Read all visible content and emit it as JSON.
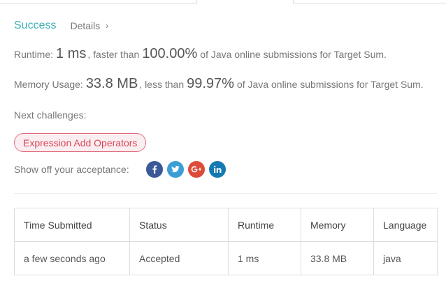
{
  "status": {
    "result": "Success",
    "details_label": "Details",
    "details_chevron": "›"
  },
  "runtime": {
    "label": "Runtime:",
    "value": "1 ms",
    "compare_text": ", faster than",
    "percent": "100.00%",
    "suffix": "of Java online submissions for Target Sum."
  },
  "memory": {
    "label": "Memory Usage:",
    "value": "33.8 MB",
    "compare_text": ", less than",
    "percent": "99.97%",
    "suffix": "of Java online submissions for Target Sum."
  },
  "next_challenges": {
    "label": "Next challenges:",
    "items": [
      "Expression Add Operators"
    ]
  },
  "share": {
    "label": "Show off your acceptance:",
    "icons": [
      "facebook-icon",
      "twitter-icon",
      "google-plus-icon",
      "linkedin-icon"
    ]
  },
  "table": {
    "headers": [
      "Time Submitted",
      "Status",
      "Runtime",
      "Memory",
      "Language"
    ],
    "rows": [
      [
        "a few seconds ago",
        "Accepted",
        "1 ms",
        "33.8 MB",
        "java"
      ]
    ]
  },
  "colors": {
    "success": "#3eb0b8",
    "accepted": "#2e9a5c",
    "challenge_border": "#e26b7c",
    "challenge_text": "#d9455b"
  }
}
